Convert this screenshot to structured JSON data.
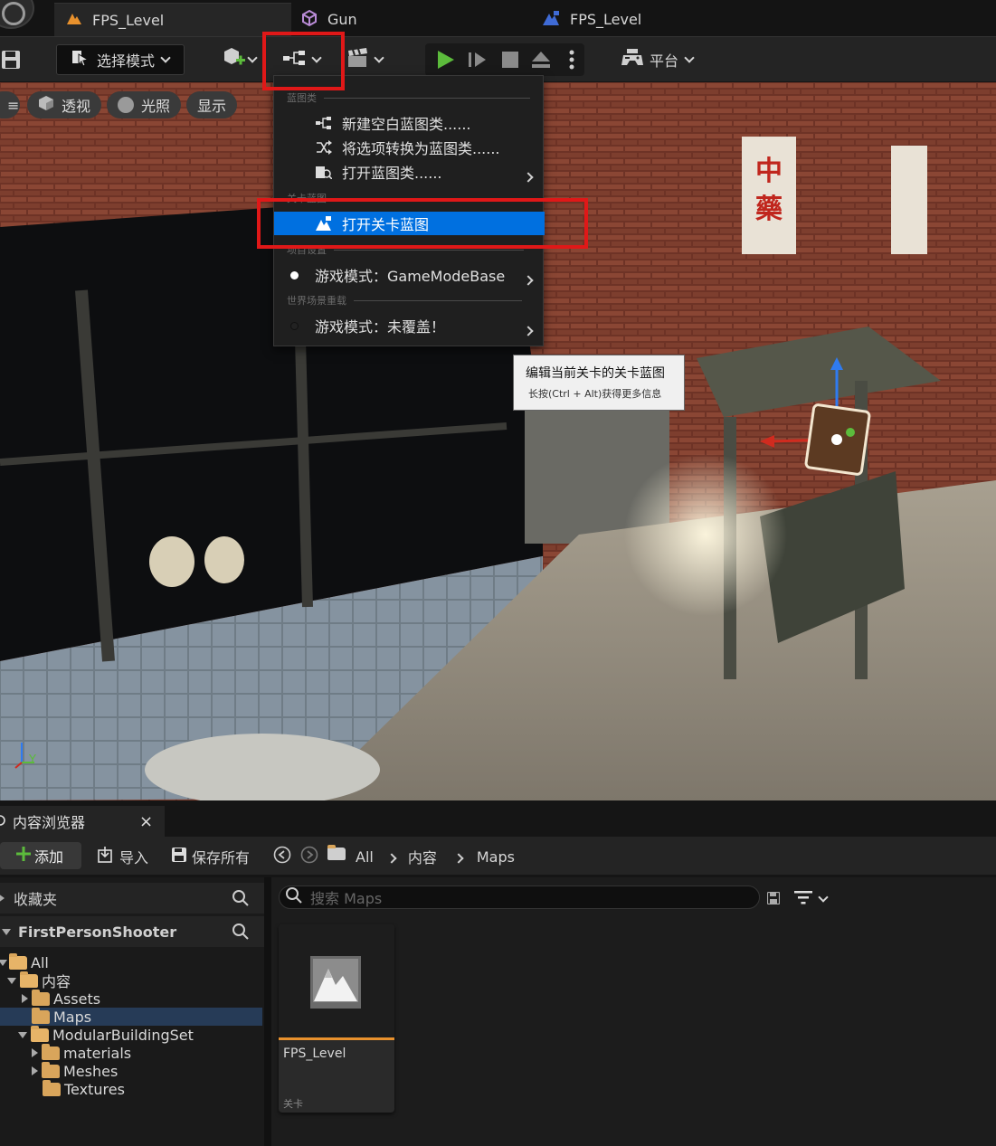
{
  "tabs": [
    {
      "label": "FPS_Level",
      "icon": "level-icon",
      "active": true
    },
    {
      "label": "Gun",
      "icon": "blueprint-icon",
      "active": false
    },
    {
      "label": "FPS_Level",
      "icon": "level-blueprint-icon",
      "active": false
    }
  ],
  "toolbar": {
    "select_mode_label": "选择模式",
    "platform_label": "平台"
  },
  "viewport": {
    "menu_button": "≡",
    "perspective_label": "透视",
    "lighting_label": "光照",
    "show_label": "显示",
    "axis_z": "Z",
    "axis_y": "Y",
    "sign_text_chinese": "中藥"
  },
  "blueprint_menu": {
    "section_blueprint_class": "蓝图类",
    "item_new_empty_blueprint": "新建空白蓝图类......",
    "item_convert_to_blueprint": "将选项转换为蓝图类......",
    "item_open_blueprint_class": "打开蓝图类......",
    "section_level_blueprint": "关卡蓝图",
    "item_open_level_blueprint": "打开关卡蓝图",
    "section_project_settings": "项目设置",
    "item_game_mode": "游戏模式：GameModeBase",
    "section_world_override": "世界场景重载",
    "item_game_mode_override": "游戏模式：未覆盖！"
  },
  "tooltip": {
    "title": "编辑当前关卡的关卡蓝图",
    "hint": "长按(Ctrl + Alt)获得更多信息"
  },
  "content_browser": {
    "tab_label": "内容浏览器",
    "close_label": "×",
    "add_label": "添加",
    "import_label": "导入",
    "save_all_label": "保存所有",
    "breadcrumb": [
      "All",
      "内容",
      "Maps"
    ],
    "favorites_label": "收藏夹",
    "project_label": "FirstPersonShooter",
    "tree": [
      {
        "label": "All",
        "depth": 0,
        "expanded": true,
        "selected": false,
        "arrow": "down"
      },
      {
        "label": "内容",
        "depth": 1,
        "expanded": true,
        "selected": false,
        "arrow": "down"
      },
      {
        "label": "Assets",
        "depth": 2,
        "expanded": false,
        "selected": false,
        "arrow": "right"
      },
      {
        "label": "Maps",
        "depth": 2,
        "expanded": false,
        "selected": true,
        "arrow": "none"
      },
      {
        "label": "ModularBuildingSet",
        "depth": 2,
        "expanded": true,
        "selected": false,
        "arrow": "down"
      },
      {
        "label": "materials",
        "depth": 3,
        "expanded": false,
        "selected": false,
        "arrow": "right"
      },
      {
        "label": "Meshes",
        "depth": 3,
        "expanded": false,
        "selected": false,
        "arrow": "right"
      },
      {
        "label": "Textures",
        "depth": 3,
        "expanded": false,
        "selected": false,
        "arrow": "none"
      }
    ],
    "search_placeholder": "搜索 Maps",
    "asset": {
      "name": "FPS_Level",
      "type": "关卡"
    }
  },
  "colors": {
    "accent_blue": "#0070e0",
    "highlight_red": "#e01818",
    "level_orange": "#e8912d",
    "play_green": "#5cbb3c"
  }
}
